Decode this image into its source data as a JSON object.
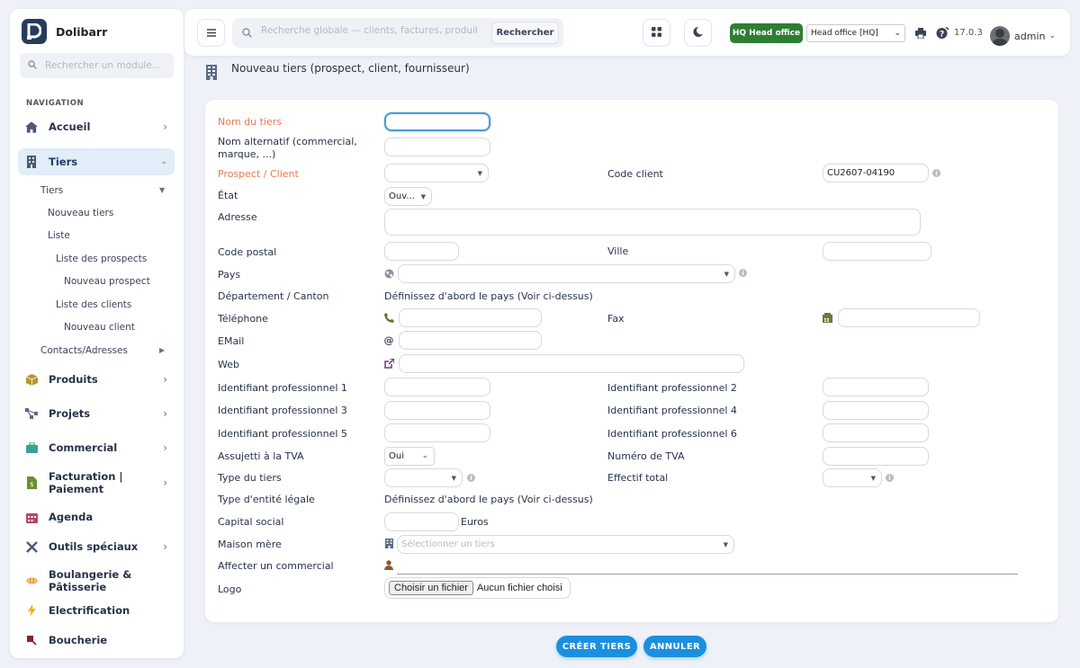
{
  "brand": {
    "name": "Dolibarr"
  },
  "module_search": {
    "placeholder": "Rechercher un module..."
  },
  "nav": {
    "title": "NAVIGATION",
    "items": [
      {
        "label": "Accueil",
        "icon": "home-icon"
      },
      {
        "label": "Tiers",
        "icon": "building-icon"
      },
      {
        "label": "Produits",
        "icon": "box-icon"
      },
      {
        "label": "Projets",
        "icon": "project-icon"
      },
      {
        "label": "Commercial",
        "icon": "briefcase-icon"
      },
      {
        "label": "Facturation | Paiement",
        "icon": "bill-icon"
      },
      {
        "label": "Agenda",
        "icon": "calendar-icon"
      },
      {
        "label": "Outils spéciaux",
        "icon": "tools-icon"
      },
      {
        "label": "Boulangerie & Pâtisserie",
        "icon": "bread-icon"
      },
      {
        "label": "Electrification",
        "icon": "bolt-icon"
      },
      {
        "label": "Boucherie",
        "icon": "meat-icon"
      }
    ],
    "sub": {
      "tiers": "Tiers",
      "nouveau_tiers": "Nouveau tiers",
      "liste": "Liste",
      "liste_prospects": "Liste des prospects",
      "nouveau_prospect": "Nouveau prospect",
      "liste_clients": "Liste des clients",
      "nouveau_client": "Nouveau client",
      "contacts": "Contacts/Adresses"
    }
  },
  "topbar": {
    "search_placeholder": "Recherche globale — clients, factures, produits...",
    "search_button": "Rechercher",
    "hq_badge": "HQ Head office",
    "entity": "Head office [HQ]",
    "version": "17.0.3",
    "user": "admin"
  },
  "page": {
    "title": "Nouveau tiers (prospect, client, fournisseur)"
  },
  "form": {
    "nom_tiers": "Nom du tiers",
    "nom_alt": "Nom alternatif (commercial, marque, ...)",
    "prospect_client": "Prospect / Client",
    "code_client_label": "Code client",
    "code_client_value": "CU2607-04190",
    "etat": "État",
    "etat_value": "Ouv...",
    "adresse": "Adresse",
    "code_postal": "Code postal",
    "ville": "Ville",
    "pays": "Pays",
    "departement": "Département / Canton",
    "departement_hint": "Définissez d'abord le pays (Voir ci-dessus)",
    "telephone": "Téléphone",
    "fax": "Fax",
    "email": "EMail",
    "web": "Web",
    "id_prof_1": "Identifiant professionnel 1",
    "id_prof_2": "Identifiant professionnel 2",
    "id_prof_3": "Identifiant professionnel 3",
    "id_prof_4": "Identifiant professionnel 4",
    "id_prof_5": "Identifiant professionnel 5",
    "id_prof_6": "Identifiant professionnel 6",
    "tva_label": "Assujetti à la TVA",
    "tva_value": "Oui",
    "num_tva": "Numéro de TVA",
    "type_tiers": "Type du tiers",
    "effectif": "Effectif total",
    "type_entite": "Type d'entité légale",
    "type_entite_hint": "Définissez d'abord le pays (Voir ci-dessus)",
    "capital": "Capital social",
    "capital_unit": "Euros",
    "maison_mere": "Maison mère",
    "maison_mere_placeholder": "Sélectionner un tiers",
    "commercial": "Affecter un commercial",
    "logo": "Logo",
    "file_button": "Choisir un fichier",
    "file_status": "Aucun fichier choisi"
  },
  "actions": {
    "create": "CRÉER TIERS",
    "cancel": "ANNULER"
  },
  "colors": {
    "accent": "#1a8fe0",
    "required": "#e57a52",
    "hq": "#2f7d32",
    "brand": "#263c5c"
  }
}
